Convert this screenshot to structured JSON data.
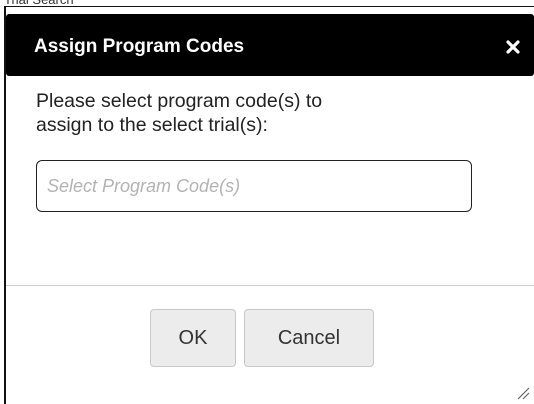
{
  "dialog": {
    "title": "Assign Program Codes",
    "close_glyph": "×",
    "prompt_line1": "Please select program code(s) to",
    "prompt_line2": "assign to the select trial(s):",
    "select_placeholder": "Select Program Code(s)",
    "ok_label": "OK",
    "cancel_label": "Cancel"
  },
  "icons": {
    "close": "close-icon",
    "resize": "resize-grip-icon"
  },
  "colors": {
    "titlebar_bg": "#000000",
    "title_text": "#ffffff",
    "button_bg": "#ececec",
    "placeholder": "#b3b3b3"
  }
}
